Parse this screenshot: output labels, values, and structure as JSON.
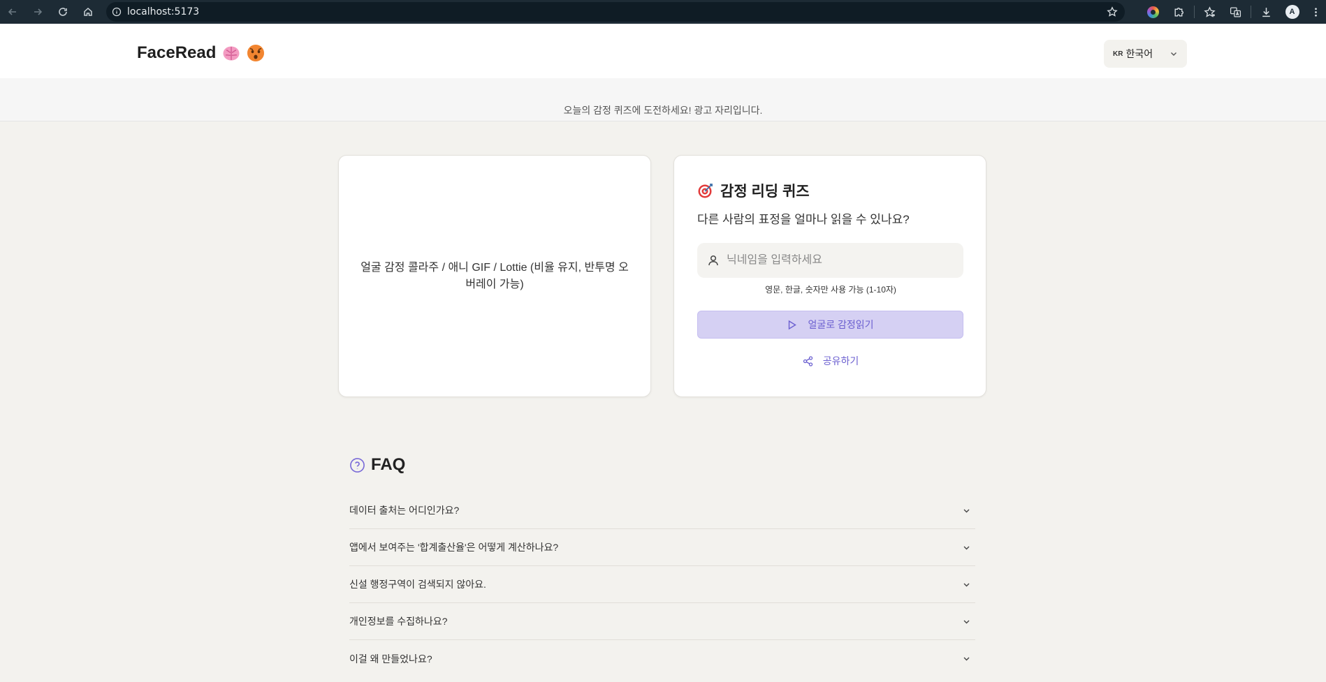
{
  "browser": {
    "url": "localhost:5173"
  },
  "header": {
    "logo_text": "FaceRead",
    "language": {
      "flag_code": "KR",
      "selected": "한국어"
    }
  },
  "ad": {
    "text": "오늘의 감정 퀴즈에 도전하세요! 광고 자리입니다."
  },
  "collage": {
    "text": "얼굴 감정 콜라주 / 애니 GIF / Lottie (비율 유지, 반투명 오버레이 가능)"
  },
  "quiz": {
    "title": "감정 리딩 퀴즈",
    "subtitle": "다른 사람의 표정을 얼마나 읽을 수 있나요?",
    "nickname_placeholder": "닉네임을 입력하세요",
    "nickname_value": "",
    "hint": "영문, 한글, 숫자만 사용 가능 (1-10자)",
    "start_button": "얼굴로 감정읽기",
    "share_button": "공유하기"
  },
  "faq": {
    "title": "FAQ",
    "items": [
      "데이터 출처는 어디인가요?",
      "앱에서 보여주는 '합계출산율'은 어떻게 계산하나요?",
      "신설 행정구역이 검색되지 않아요.",
      "개인정보를 수집하나요?",
      "이걸 왜 만들었나요?"
    ]
  },
  "colors": {
    "accent": "#6b5fd0",
    "accent_light": "#d5d0f3",
    "page_bg": "#f3f2ee",
    "browser_bar": "#1d2b35"
  },
  "icons": [
    "back-arrow-icon",
    "forward-arrow-icon",
    "reload-icon",
    "home-icon",
    "site-info-icon",
    "bookmark-star-icon",
    "brain-emoji-icon",
    "face-emoji-icon",
    "chevron-down-icon",
    "target-icon",
    "user-icon",
    "play-icon",
    "share-icon",
    "question-circle-icon"
  ]
}
